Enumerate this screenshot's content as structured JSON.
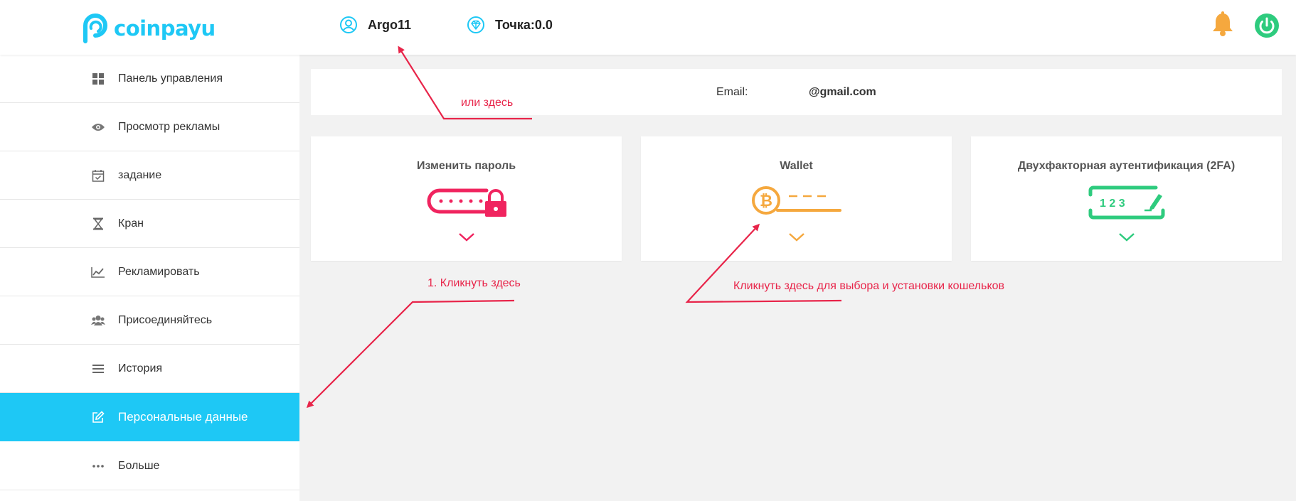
{
  "header": {
    "logo_text": "coinpayu",
    "username": "Argo11",
    "points_text": "Точка:0.0",
    "accent": "#1ec8f5",
    "icons": [
      "user-icon",
      "diamond-icon",
      "bell-icon",
      "power-icon"
    ]
  },
  "sidebar": {
    "items": [
      {
        "label": "Панель управления",
        "icon": "dashboard-icon"
      },
      {
        "label": "Просмотр рекламы",
        "icon": "eye-icon"
      },
      {
        "label": "задание",
        "icon": "calendar-check-icon"
      },
      {
        "label": "Кран",
        "icon": "hourglass-icon"
      },
      {
        "label": "Рекламировать",
        "icon": "chart-line-icon"
      },
      {
        "label": "Присоединяйтесь",
        "icon": "users-icon"
      },
      {
        "label": "История",
        "icon": "list-icon"
      },
      {
        "label": "Персональные данные",
        "icon": "edit-icon",
        "active": true
      },
      {
        "label": "Больше",
        "icon": "more-icon"
      }
    ]
  },
  "main": {
    "email_label": "Email:",
    "email_value": "@gmail.com",
    "cards": [
      {
        "title": "Изменить пароль",
        "color": "#f0245f"
      },
      {
        "title": "Wallet",
        "color": "#f5a83e"
      },
      {
        "title": "Двухфакторная аутентификация (2FA)",
        "color": "#2ecb7e",
        "code": "1 2 3"
      }
    ]
  },
  "annotations": {
    "here_too": "или здесь",
    "click_here": "1. Кликнуть здесь",
    "wallets_hint": "Кликнуть здесь для выбора и установки кошельков",
    "color": "#e8254a"
  }
}
